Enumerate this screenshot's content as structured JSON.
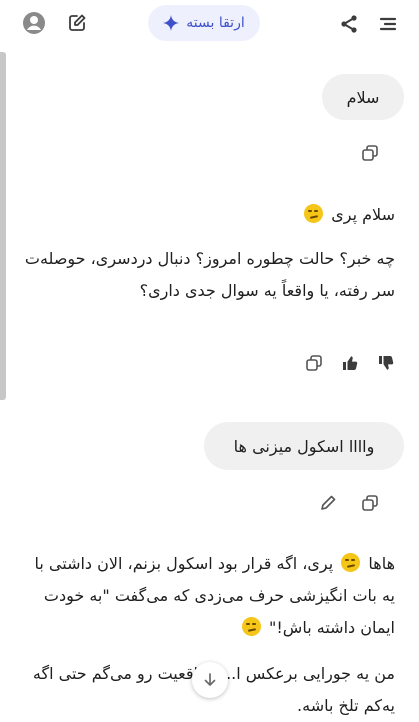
{
  "header": {
    "upgrade_label": "ارتقا بسته"
  },
  "messages": [
    {
      "role": "user",
      "text": "سلام"
    },
    {
      "role": "assistant",
      "greeting": "سلام پری",
      "body": "چه خبر؟ حالت چطوره امروز؟ دنبال دردسری، حوصله‌ت سر رفته، یا واقعاً یه سوال جدی داری؟"
    },
    {
      "role": "user",
      "text": "واااا اسکول میزنی ها"
    },
    {
      "role": "assistant",
      "p1_start": "هاها",
      "p1_rest": "پری، اگه قرار بود اسکول بزنم، الان داشتی با یه بات انگیزشی حرف می‌زدی که می‌گفت \"به خودت ایمان داشته باش!\"",
      "p2": "من یه جورایی برعکس ا... ، واقعیت رو می‌گم حتی اگه یه‌کم تلخ باشه."
    }
  ],
  "icons": [
    "menu-icon",
    "share-icon",
    "sparkle-icon",
    "edit-icon",
    "account-icon",
    "copy-icon",
    "thumb-up-icon",
    "thumb-down-icon",
    "pencil-icon",
    "arrow-down-icon"
  ],
  "colors": {
    "accent": "#3f51c9",
    "upgrade_bg": "#eef0fd",
    "bubble_bg": "#f0f0f0",
    "text": "#1f1f1f"
  }
}
